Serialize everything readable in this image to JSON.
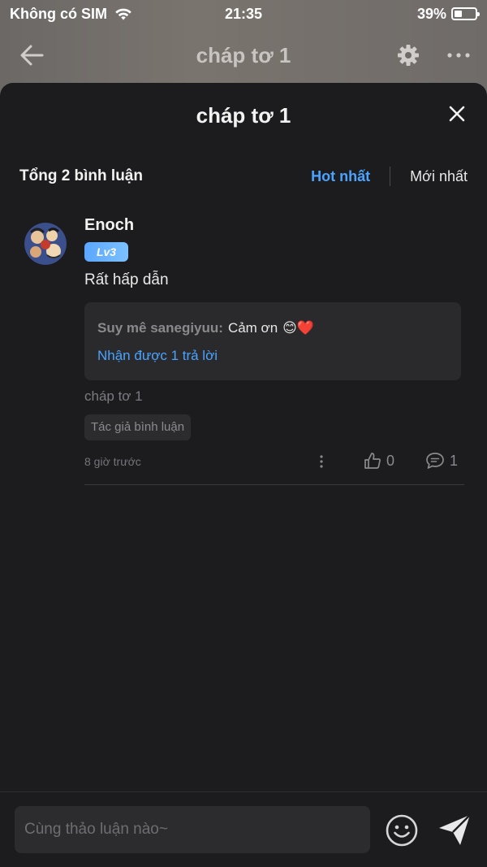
{
  "status_bar": {
    "carrier": "Không có SIM",
    "time": "21:35",
    "battery": "39%",
    "battery_level": 0.39
  },
  "nav": {
    "title": "cháp tơ 1"
  },
  "sheet": {
    "title": "cháp tơ 1",
    "total_label": "Tổng 2 bình luận",
    "sort_tabs": [
      {
        "label": "Hot nhất",
        "active": true
      },
      {
        "label": "Mới nhất",
        "active": false
      }
    ]
  },
  "comment": {
    "user_name": "Enoch",
    "level": "Lv3",
    "text": "Rất hấp dẫn",
    "reply": {
      "author": "Suy mê sanegiyuu:",
      "text": "Cảm ơn",
      "emojis": "😊❤️",
      "reply_count_label": "Nhận được 1 trả lời"
    },
    "chapter_ref": "cháp tơ 1",
    "author_tag": "Tác giả bình luận",
    "timestamp": "8 giờ trước",
    "likes": "0",
    "replies": "1"
  },
  "input": {
    "placeholder": "Cùng thảo luận nào~"
  },
  "colors": {
    "accent": "#4aa3ff",
    "sheet_bg": "#1c1c1e"
  }
}
